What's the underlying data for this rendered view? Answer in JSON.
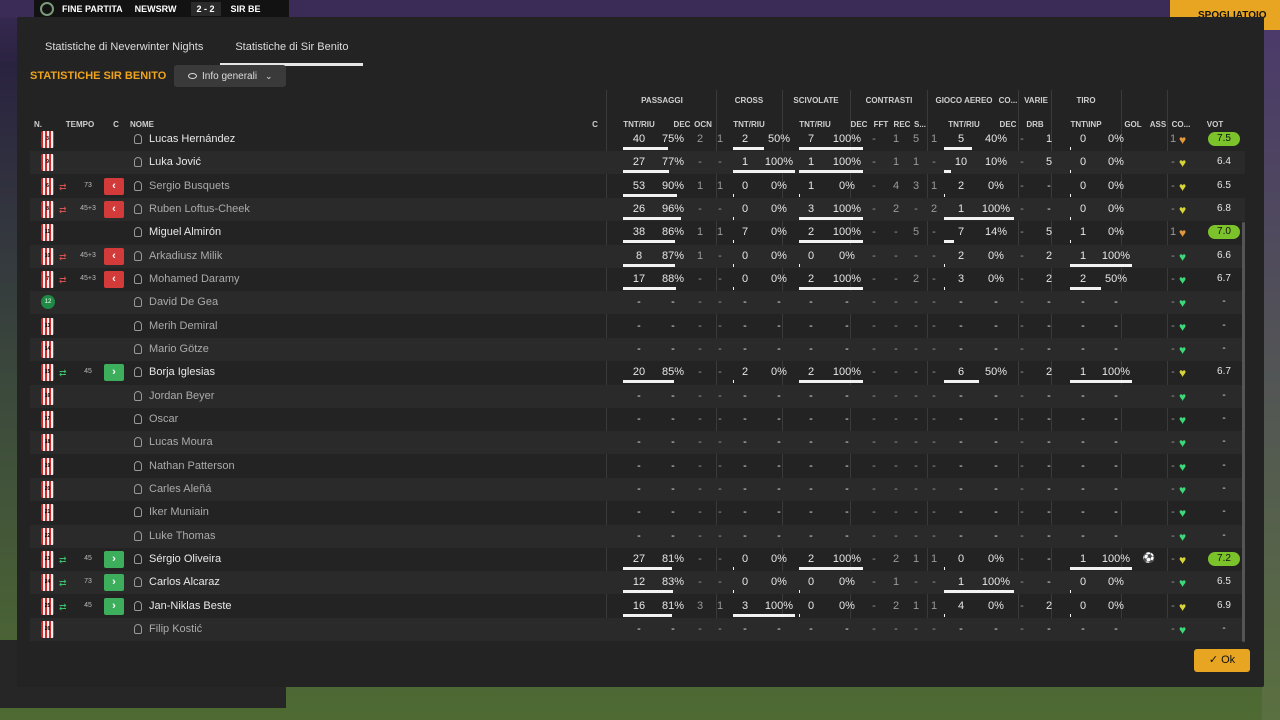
{
  "background": {
    "match_status": "FINE PARTITA",
    "home": "NEWSRW",
    "score": "2 - 2",
    "away": "SIR BE",
    "action": "SPOGLIATOIO"
  },
  "tabs": [
    "Statistiche di Neverwinter Nights",
    "Statistiche di Sir Benito"
  ],
  "title": "STATISTICHE SIR BENITO",
  "dropdown": "Info generali",
  "groups": {
    "passaggi": "PASSAGGI",
    "cross": "CROSS",
    "scivolate": "SCIVOLATE",
    "contrasti": "CONTRASTI",
    "gioco_aereo": "GIOCO AEREO",
    "co": "CO...",
    "varie": "VARIE",
    "tiro": "TIRO"
  },
  "cols": {
    "n": "N.",
    "tempo": "TEMPO",
    "c": "C",
    "nome": "NOME",
    "c2": "C",
    "pass_tnt": "TNT/RIU",
    "dec": "DEC",
    "ocn": "OCN",
    "cross_tnt": "TNT/RIU",
    "sciv_tnt": "TNT/RIU",
    "con_dec": "DEC",
    "con_fft": "FFT",
    "con_rec": "REC",
    "con_s": "S...",
    "aer_tnt": "TNT/RIU",
    "co_dec": "DEC",
    "drb": "DRB",
    "tiro": "TNT\\INP",
    "gol": "GOL",
    "ass": "ASS",
    "co2": "CO...",
    "vot": "VOT"
  },
  "colors": {
    "accent": "#f0a31d",
    "out": "#d33b3b",
    "in": "#3cae5c",
    "heart_green": "#3dd878",
    "heart_yellow": "#d9d43a",
    "heart_orange": "#e39a3a"
  },
  "players": [
    {
      "num": "3",
      "gk": false,
      "name": "Lucas Hernández",
      "dim": false,
      "sub": "",
      "tempo": "",
      "pa": "40",
      "pb": "75%",
      "pbar": 0.75,
      "pdec": "2",
      "pocn": "1",
      "ca": "2",
      "cb": "50%",
      "cbar": 0.5,
      "sa": "7",
      "sb": "100%",
      "sbar": 1,
      "cd": "-",
      "cf": "1",
      "cr": "5",
      "cs": "1",
      "aa": "5",
      "ab": "40%",
      "abar": 0.4,
      "od": "-",
      "dr": "1",
      "ta": "0",
      "tb": "0%",
      "tbar": 0,
      "gol": "",
      "ass": "1",
      "heart": "orange",
      "vote": "7.5",
      "vg": true
    },
    {
      "num": "9",
      "gk": false,
      "name": "Luka Jović",
      "dim": false,
      "sub": "",
      "tempo": "",
      "pa": "27",
      "pb": "77%",
      "pbar": 0.77,
      "pdec": "-",
      "pocn": "-",
      "ca": "1",
      "cb": "100%",
      "cbar": 1,
      "sa": "1",
      "sb": "100%",
      "sbar": 1,
      "cd": "-",
      "cf": "1",
      "cr": "1",
      "cs": "-",
      "aa": "10",
      "ab": "10%",
      "abar": 0.1,
      "od": "-",
      "dr": "5",
      "ta": "0",
      "tb": "0%",
      "tbar": 0,
      "gol": "",
      "ass": "-",
      "heart": "yellow",
      "vote": "6.4",
      "vg": false
    },
    {
      "num": "6",
      "gk": false,
      "name": "Sergio Busquets",
      "dim": true,
      "sub": "out",
      "tempo": "73",
      "pa": "53",
      "pb": "90%",
      "pbar": 0.9,
      "pdec": "1",
      "pocn": "1",
      "ca": "0",
      "cb": "0%",
      "cbar": 0,
      "sa": "1",
      "sb": "0%",
      "sbar": 0,
      "cd": "-",
      "cf": "4",
      "cr": "3",
      "cs": "1",
      "aa": "2",
      "ab": "0%",
      "abar": 0,
      "od": "-",
      "dr": "-",
      "ta": "0",
      "tb": "0%",
      "tbar": 0,
      "gol": "",
      "ass": "-",
      "heart": "yellow",
      "vote": "6.5",
      "vg": false
    },
    {
      "num": "8",
      "gk": false,
      "name": "Ruben Loftus-Cheek",
      "dim": true,
      "sub": "out",
      "tempo": "45+3",
      "pa": "26",
      "pb": "96%",
      "pbar": 0.96,
      "pdec": "-",
      "pocn": "-",
      "ca": "0",
      "cb": "0%",
      "cbar": 0,
      "sa": "3",
      "sb": "100%",
      "sbar": 1,
      "cd": "-",
      "cf": "2",
      "cr": "-",
      "cs": "2",
      "aa": "1",
      "ab": "100%",
      "abar": 1,
      "od": "-",
      "dr": "-",
      "ta": "0",
      "tb": "0%",
      "tbar": 0,
      "gol": "",
      "ass": "-",
      "heart": "yellow",
      "vote": "6.8",
      "vg": false
    },
    {
      "num": "11",
      "gk": false,
      "name": "Miguel Almirón",
      "dim": false,
      "sub": "",
      "tempo": "",
      "pa": "38",
      "pb": "86%",
      "pbar": 0.86,
      "pdec": "1",
      "pocn": "1",
      "ca": "7",
      "cb": "0%",
      "cbar": 0,
      "sa": "2",
      "sb": "100%",
      "sbar": 1,
      "cd": "-",
      "cf": "-",
      "cr": "5",
      "cs": "-",
      "aa": "7",
      "ab": "14%",
      "abar": 0.14,
      "od": "-",
      "dr": "5",
      "ta": "1",
      "tb": "0%",
      "tbar": 0,
      "gol": "",
      "ass": "1",
      "heart": "orange",
      "vote": "7.0",
      "vg": true
    },
    {
      "num": "10",
      "gk": false,
      "name": "Arkadiusz Milik",
      "dim": true,
      "sub": "out",
      "tempo": "45+3",
      "pa": "8",
      "pb": "87%",
      "pbar": 0.87,
      "pdec": "1",
      "pocn": "-",
      "ca": "0",
      "cb": "0%",
      "cbar": 0,
      "sa": "0",
      "sb": "0%",
      "sbar": 0,
      "cd": "-",
      "cf": "-",
      "cr": "-",
      "cs": "-",
      "aa": "2",
      "ab": "0%",
      "abar": 0,
      "od": "-",
      "dr": "2",
      "ta": "1",
      "tb": "100%",
      "tbar": 1,
      "gol": "",
      "ass": "-",
      "heart": "green",
      "vote": "6.6",
      "vg": false
    },
    {
      "num": "7",
      "gk": false,
      "name": "Mohamed Daramy",
      "dim": true,
      "sub": "out",
      "tempo": "45+3",
      "pa": "17",
      "pb": "88%",
      "pbar": 0.88,
      "pdec": "-",
      "pocn": "-",
      "ca": "0",
      "cb": "0%",
      "cbar": 0,
      "sa": "2",
      "sb": "100%",
      "sbar": 1,
      "cd": "-",
      "cf": "-",
      "cr": "2",
      "cs": "-",
      "aa": "3",
      "ab": "0%",
      "abar": 0,
      "od": "-",
      "dr": "2",
      "ta": "2",
      "tb": "50%",
      "tbar": 0.5,
      "gol": "",
      "ass": "-",
      "heart": "green",
      "vote": "6.7",
      "vg": false
    },
    {
      "num": "12",
      "gk": true,
      "name": "David De Gea",
      "dim": true,
      "sub": "",
      "tempo": "",
      "empty": true,
      "heart": "green",
      "vote": "-"
    },
    {
      "num": "13",
      "gk": false,
      "name": "Merih Demiral",
      "dim": true,
      "sub": "",
      "tempo": "",
      "empty": true,
      "heart": "green",
      "vote": "-"
    },
    {
      "num": "14",
      "gk": false,
      "name": "Mario Götze",
      "dim": true,
      "sub": "",
      "tempo": "",
      "empty": true,
      "heart": "green",
      "vote": "-"
    },
    {
      "num": "15",
      "gk": false,
      "name": "Borja Iglesias",
      "dim": false,
      "sub": "in",
      "tempo": "45",
      "pa": "20",
      "pb": "85%",
      "pbar": 0.85,
      "pdec": "-",
      "pocn": "-",
      "ca": "2",
      "cb": "0%",
      "cbar": 0,
      "sa": "2",
      "sb": "100%",
      "sbar": 1,
      "cd": "-",
      "cf": "-",
      "cr": "-",
      "cs": "-",
      "aa": "6",
      "ab": "50%",
      "abar": 0.5,
      "od": "-",
      "dr": "2",
      "ta": "1",
      "tb": "100%",
      "tbar": 1,
      "gol": "",
      "ass": "-",
      "heart": "yellow",
      "vote": "6.7",
      "vg": false
    },
    {
      "num": "16",
      "gk": false,
      "name": "Jordan Beyer",
      "dim": true,
      "sub": "",
      "tempo": "",
      "empty": true,
      "heart": "green",
      "vote": "-"
    },
    {
      "num": "17",
      "gk": false,
      "name": "Oscar",
      "dim": true,
      "sub": "",
      "tempo": "",
      "empty": true,
      "heart": "green",
      "vote": "-"
    },
    {
      "num": "18",
      "gk": false,
      "name": "Lucas Moura",
      "dim": true,
      "sub": "",
      "tempo": "",
      "empty": true,
      "heart": "green",
      "vote": "-"
    },
    {
      "num": "19",
      "gk": false,
      "name": "Nathan Patterson",
      "dim": true,
      "sub": "",
      "tempo": "",
      "empty": true,
      "heart": "green",
      "vote": "-"
    },
    {
      "num": "20",
      "gk": false,
      "name": "Carles Aleñá",
      "dim": true,
      "sub": "",
      "tempo": "",
      "empty": true,
      "heart": "green",
      "vote": "-"
    },
    {
      "num": "21",
      "gk": false,
      "name": "Iker Muniain",
      "dim": true,
      "sub": "",
      "tempo": "",
      "empty": true,
      "heart": "green",
      "vote": "-"
    },
    {
      "num": "22",
      "gk": false,
      "name": "Luke Thomas",
      "dim": true,
      "sub": "",
      "tempo": "",
      "empty": true,
      "heart": "green",
      "vote": "-"
    },
    {
      "num": "23",
      "gk": false,
      "name": "Sérgio Oliveira",
      "dim": false,
      "sub": "in",
      "tempo": "45",
      "pa": "27",
      "pb": "81%",
      "pbar": 0.81,
      "pdec": "-",
      "pocn": "-",
      "ca": "0",
      "cb": "0%",
      "cbar": 0,
      "sa": "2",
      "sb": "100%",
      "sbar": 1,
      "cd": "-",
      "cf": "2",
      "cr": "1",
      "cs": "1",
      "aa": "0",
      "ab": "0%",
      "abar": 0,
      "od": "-",
      "dr": "-",
      "ta": "1",
      "tb": "100%",
      "tbar": 1,
      "gol": "ball",
      "ass": "-",
      "heart": "yellow",
      "vote": "7.2",
      "vg": true
    },
    {
      "num": "24",
      "gk": false,
      "name": "Carlos Alcaraz",
      "dim": false,
      "sub": "in",
      "tempo": "73",
      "pa": "12",
      "pb": "83%",
      "pbar": 0.83,
      "pdec": "-",
      "pocn": "-",
      "ca": "0",
      "cb": "0%",
      "cbar": 0,
      "sa": "0",
      "sb": "0%",
      "sbar": 0,
      "cd": "-",
      "cf": "1",
      "cr": "-",
      "cs": "-",
      "aa": "1",
      "ab": "100%",
      "abar": 1,
      "od": "-",
      "dr": "-",
      "ta": "0",
      "tb": "0%",
      "tbar": 0,
      "gol": "",
      "ass": "-",
      "heart": "green",
      "vote": "6.5",
      "vg": false
    },
    {
      "num": "25",
      "gk": false,
      "name": "Jan-Niklas Beste",
      "dim": false,
      "sub": "in",
      "tempo": "45",
      "pa": "16",
      "pb": "81%",
      "pbar": 0.81,
      "pdec": "3",
      "pocn": "1",
      "ca": "3",
      "cb": "100%",
      "cbar": 1,
      "sa": "0",
      "sb": "0%",
      "sbar": 0,
      "cd": "-",
      "cf": "2",
      "cr": "1",
      "cs": "1",
      "aa": "4",
      "ab": "0%",
      "abar": 0,
      "od": "-",
      "dr": "2",
      "ta": "0",
      "tb": "0%",
      "tbar": 0,
      "gol": "",
      "ass": "-",
      "heart": "yellow",
      "vote": "6.9",
      "vg": false
    },
    {
      "num": "26",
      "gk": false,
      "name": "Filip Kostić",
      "dim": true,
      "sub": "",
      "tempo": "",
      "empty": true,
      "heart": "green",
      "vote": "-"
    }
  ],
  "ok_label": "Ok"
}
